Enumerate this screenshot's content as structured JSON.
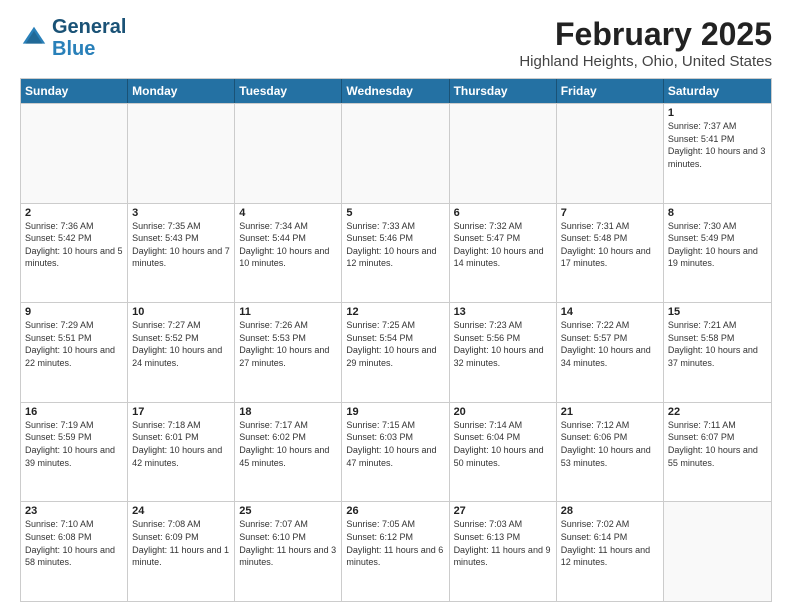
{
  "header": {
    "logo_line1": "General",
    "logo_line2": "Blue",
    "title": "February 2025",
    "subtitle": "Highland Heights, Ohio, United States"
  },
  "days_of_week": [
    "Sunday",
    "Monday",
    "Tuesday",
    "Wednesday",
    "Thursday",
    "Friday",
    "Saturday"
  ],
  "weeks": [
    [
      {
        "day": "",
        "info": ""
      },
      {
        "day": "",
        "info": ""
      },
      {
        "day": "",
        "info": ""
      },
      {
        "day": "",
        "info": ""
      },
      {
        "day": "",
        "info": ""
      },
      {
        "day": "",
        "info": ""
      },
      {
        "day": "1",
        "info": "Sunrise: 7:37 AM\nSunset: 5:41 PM\nDaylight: 10 hours and 3 minutes."
      }
    ],
    [
      {
        "day": "2",
        "info": "Sunrise: 7:36 AM\nSunset: 5:42 PM\nDaylight: 10 hours and 5 minutes."
      },
      {
        "day": "3",
        "info": "Sunrise: 7:35 AM\nSunset: 5:43 PM\nDaylight: 10 hours and 7 minutes."
      },
      {
        "day": "4",
        "info": "Sunrise: 7:34 AM\nSunset: 5:44 PM\nDaylight: 10 hours and 10 minutes."
      },
      {
        "day": "5",
        "info": "Sunrise: 7:33 AM\nSunset: 5:46 PM\nDaylight: 10 hours and 12 minutes."
      },
      {
        "day": "6",
        "info": "Sunrise: 7:32 AM\nSunset: 5:47 PM\nDaylight: 10 hours and 14 minutes."
      },
      {
        "day": "7",
        "info": "Sunrise: 7:31 AM\nSunset: 5:48 PM\nDaylight: 10 hours and 17 minutes."
      },
      {
        "day": "8",
        "info": "Sunrise: 7:30 AM\nSunset: 5:49 PM\nDaylight: 10 hours and 19 minutes."
      }
    ],
    [
      {
        "day": "9",
        "info": "Sunrise: 7:29 AM\nSunset: 5:51 PM\nDaylight: 10 hours and 22 minutes."
      },
      {
        "day": "10",
        "info": "Sunrise: 7:27 AM\nSunset: 5:52 PM\nDaylight: 10 hours and 24 minutes."
      },
      {
        "day": "11",
        "info": "Sunrise: 7:26 AM\nSunset: 5:53 PM\nDaylight: 10 hours and 27 minutes."
      },
      {
        "day": "12",
        "info": "Sunrise: 7:25 AM\nSunset: 5:54 PM\nDaylight: 10 hours and 29 minutes."
      },
      {
        "day": "13",
        "info": "Sunrise: 7:23 AM\nSunset: 5:56 PM\nDaylight: 10 hours and 32 minutes."
      },
      {
        "day": "14",
        "info": "Sunrise: 7:22 AM\nSunset: 5:57 PM\nDaylight: 10 hours and 34 minutes."
      },
      {
        "day": "15",
        "info": "Sunrise: 7:21 AM\nSunset: 5:58 PM\nDaylight: 10 hours and 37 minutes."
      }
    ],
    [
      {
        "day": "16",
        "info": "Sunrise: 7:19 AM\nSunset: 5:59 PM\nDaylight: 10 hours and 39 minutes."
      },
      {
        "day": "17",
        "info": "Sunrise: 7:18 AM\nSunset: 6:01 PM\nDaylight: 10 hours and 42 minutes."
      },
      {
        "day": "18",
        "info": "Sunrise: 7:17 AM\nSunset: 6:02 PM\nDaylight: 10 hours and 45 minutes."
      },
      {
        "day": "19",
        "info": "Sunrise: 7:15 AM\nSunset: 6:03 PM\nDaylight: 10 hours and 47 minutes."
      },
      {
        "day": "20",
        "info": "Sunrise: 7:14 AM\nSunset: 6:04 PM\nDaylight: 10 hours and 50 minutes."
      },
      {
        "day": "21",
        "info": "Sunrise: 7:12 AM\nSunset: 6:06 PM\nDaylight: 10 hours and 53 minutes."
      },
      {
        "day": "22",
        "info": "Sunrise: 7:11 AM\nSunset: 6:07 PM\nDaylight: 10 hours and 55 minutes."
      }
    ],
    [
      {
        "day": "23",
        "info": "Sunrise: 7:10 AM\nSunset: 6:08 PM\nDaylight: 10 hours and 58 minutes."
      },
      {
        "day": "24",
        "info": "Sunrise: 7:08 AM\nSunset: 6:09 PM\nDaylight: 11 hours and 1 minute."
      },
      {
        "day": "25",
        "info": "Sunrise: 7:07 AM\nSunset: 6:10 PM\nDaylight: 11 hours and 3 minutes."
      },
      {
        "day": "26",
        "info": "Sunrise: 7:05 AM\nSunset: 6:12 PM\nDaylight: 11 hours and 6 minutes."
      },
      {
        "day": "27",
        "info": "Sunrise: 7:03 AM\nSunset: 6:13 PM\nDaylight: 11 hours and 9 minutes."
      },
      {
        "day": "28",
        "info": "Sunrise: 7:02 AM\nSunset: 6:14 PM\nDaylight: 11 hours and 12 minutes."
      },
      {
        "day": "",
        "info": ""
      }
    ]
  ]
}
